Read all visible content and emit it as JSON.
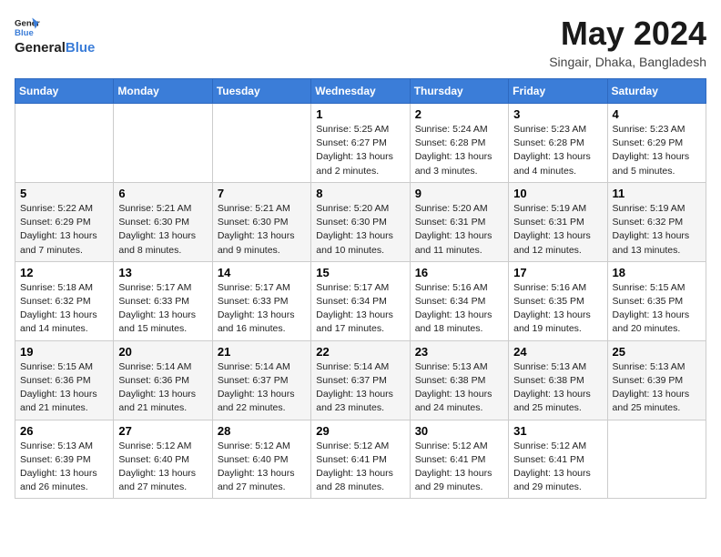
{
  "header": {
    "logo_general": "General",
    "logo_blue": "Blue",
    "month_year": "May 2024",
    "location": "Singair, Dhaka, Bangladesh"
  },
  "weekdays": [
    "Sunday",
    "Monday",
    "Tuesday",
    "Wednesday",
    "Thursday",
    "Friday",
    "Saturday"
  ],
  "weeks": [
    [
      {
        "day": "",
        "info": ""
      },
      {
        "day": "",
        "info": ""
      },
      {
        "day": "",
        "info": ""
      },
      {
        "day": "1",
        "info": "Sunrise: 5:25 AM\nSunset: 6:27 PM\nDaylight: 13 hours\nand 2 minutes."
      },
      {
        "day": "2",
        "info": "Sunrise: 5:24 AM\nSunset: 6:28 PM\nDaylight: 13 hours\nand 3 minutes."
      },
      {
        "day": "3",
        "info": "Sunrise: 5:23 AM\nSunset: 6:28 PM\nDaylight: 13 hours\nand 4 minutes."
      },
      {
        "day": "4",
        "info": "Sunrise: 5:23 AM\nSunset: 6:29 PM\nDaylight: 13 hours\nand 5 minutes."
      }
    ],
    [
      {
        "day": "5",
        "info": "Sunrise: 5:22 AM\nSunset: 6:29 PM\nDaylight: 13 hours\nand 7 minutes."
      },
      {
        "day": "6",
        "info": "Sunrise: 5:21 AM\nSunset: 6:30 PM\nDaylight: 13 hours\nand 8 minutes."
      },
      {
        "day": "7",
        "info": "Sunrise: 5:21 AM\nSunset: 6:30 PM\nDaylight: 13 hours\nand 9 minutes."
      },
      {
        "day": "8",
        "info": "Sunrise: 5:20 AM\nSunset: 6:30 PM\nDaylight: 13 hours\nand 10 minutes."
      },
      {
        "day": "9",
        "info": "Sunrise: 5:20 AM\nSunset: 6:31 PM\nDaylight: 13 hours\nand 11 minutes."
      },
      {
        "day": "10",
        "info": "Sunrise: 5:19 AM\nSunset: 6:31 PM\nDaylight: 13 hours\nand 12 minutes."
      },
      {
        "day": "11",
        "info": "Sunrise: 5:19 AM\nSunset: 6:32 PM\nDaylight: 13 hours\nand 13 minutes."
      }
    ],
    [
      {
        "day": "12",
        "info": "Sunrise: 5:18 AM\nSunset: 6:32 PM\nDaylight: 13 hours\nand 14 minutes."
      },
      {
        "day": "13",
        "info": "Sunrise: 5:17 AM\nSunset: 6:33 PM\nDaylight: 13 hours\nand 15 minutes."
      },
      {
        "day": "14",
        "info": "Sunrise: 5:17 AM\nSunset: 6:33 PM\nDaylight: 13 hours\nand 16 minutes."
      },
      {
        "day": "15",
        "info": "Sunrise: 5:17 AM\nSunset: 6:34 PM\nDaylight: 13 hours\nand 17 minutes."
      },
      {
        "day": "16",
        "info": "Sunrise: 5:16 AM\nSunset: 6:34 PM\nDaylight: 13 hours\nand 18 minutes."
      },
      {
        "day": "17",
        "info": "Sunrise: 5:16 AM\nSunset: 6:35 PM\nDaylight: 13 hours\nand 19 minutes."
      },
      {
        "day": "18",
        "info": "Sunrise: 5:15 AM\nSunset: 6:35 PM\nDaylight: 13 hours\nand 20 minutes."
      }
    ],
    [
      {
        "day": "19",
        "info": "Sunrise: 5:15 AM\nSunset: 6:36 PM\nDaylight: 13 hours\nand 21 minutes."
      },
      {
        "day": "20",
        "info": "Sunrise: 5:14 AM\nSunset: 6:36 PM\nDaylight: 13 hours\nand 21 minutes."
      },
      {
        "day": "21",
        "info": "Sunrise: 5:14 AM\nSunset: 6:37 PM\nDaylight: 13 hours\nand 22 minutes."
      },
      {
        "day": "22",
        "info": "Sunrise: 5:14 AM\nSunset: 6:37 PM\nDaylight: 13 hours\nand 23 minutes."
      },
      {
        "day": "23",
        "info": "Sunrise: 5:13 AM\nSunset: 6:38 PM\nDaylight: 13 hours\nand 24 minutes."
      },
      {
        "day": "24",
        "info": "Sunrise: 5:13 AM\nSunset: 6:38 PM\nDaylight: 13 hours\nand 25 minutes."
      },
      {
        "day": "25",
        "info": "Sunrise: 5:13 AM\nSunset: 6:39 PM\nDaylight: 13 hours\nand 25 minutes."
      }
    ],
    [
      {
        "day": "26",
        "info": "Sunrise: 5:13 AM\nSunset: 6:39 PM\nDaylight: 13 hours\nand 26 minutes."
      },
      {
        "day": "27",
        "info": "Sunrise: 5:12 AM\nSunset: 6:40 PM\nDaylight: 13 hours\nand 27 minutes."
      },
      {
        "day": "28",
        "info": "Sunrise: 5:12 AM\nSunset: 6:40 PM\nDaylight: 13 hours\nand 27 minutes."
      },
      {
        "day": "29",
        "info": "Sunrise: 5:12 AM\nSunset: 6:41 PM\nDaylight: 13 hours\nand 28 minutes."
      },
      {
        "day": "30",
        "info": "Sunrise: 5:12 AM\nSunset: 6:41 PM\nDaylight: 13 hours\nand 29 minutes."
      },
      {
        "day": "31",
        "info": "Sunrise: 5:12 AM\nSunset: 6:41 PM\nDaylight: 13 hours\nand 29 minutes."
      },
      {
        "day": "",
        "info": ""
      }
    ]
  ]
}
